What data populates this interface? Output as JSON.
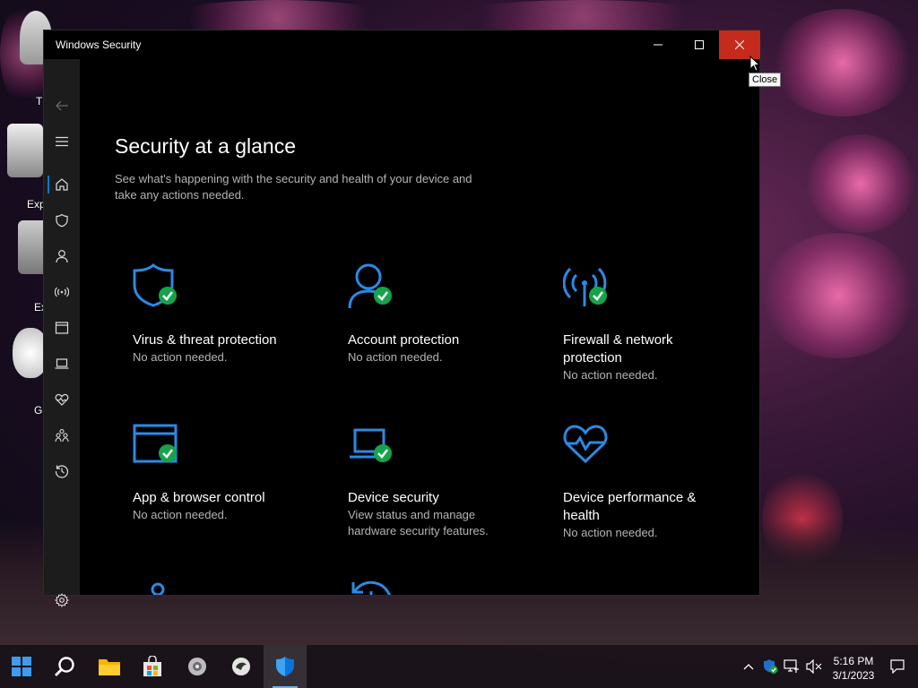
{
  "window": {
    "title": "Windows Security",
    "tooltip": "Close"
  },
  "page": {
    "heading": "Security at a glance",
    "subtitle": "See what's happening with the security and health of your device and take any actions needed."
  },
  "tiles": [
    {
      "name": "Virus & threat protection",
      "status": "No action needed.",
      "icon": "shield-check-icon"
    },
    {
      "name": "Account protection",
      "status": "No action needed.",
      "icon": "person-check-icon"
    },
    {
      "name": "Firewall & network protection",
      "status": "No action needed.",
      "icon": "antenna-check-icon"
    },
    {
      "name": "App & browser control",
      "status": "No action needed.",
      "icon": "browser-window-check-icon"
    },
    {
      "name": "Device security",
      "status": "View status and manage hardware security features.",
      "icon": "laptop-check-icon"
    },
    {
      "name": "Device performance & health",
      "status": "No action needed.",
      "icon": "heartbeat-icon"
    },
    {
      "name": "",
      "status": "",
      "icon": "family-icon"
    },
    {
      "name": "",
      "status": "",
      "icon": "history-icon"
    }
  ],
  "nav": [
    "back-icon",
    "menu-icon",
    "home-icon",
    "shield-icon",
    "person-icon",
    "antenna-icon",
    "window-icon",
    "laptop-icon",
    "heartbeat-icon",
    "family-icon",
    "history-icon",
    "settings-icon"
  ],
  "desktop": {
    "labels": [
      "T",
      "Exp",
      "Ex",
      "Ga"
    ]
  },
  "taskbar": {
    "time": "5:16 PM",
    "date": "3/1/2023"
  },
  "colors": {
    "accent": "#0078d4",
    "icon_blue": "#2b8ae3",
    "check_green": "#16a34a",
    "close_red": "#c42b1c"
  }
}
